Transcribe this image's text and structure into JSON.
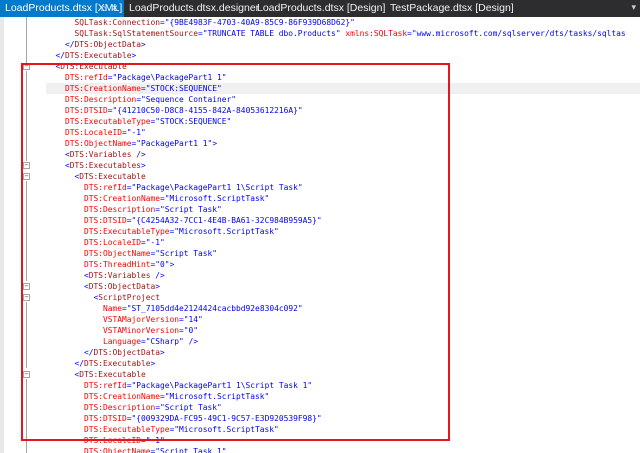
{
  "tabs": [
    {
      "label": "LoadProducts.dtsx [XML]",
      "active": true,
      "pin": "⌂",
      "close": "×"
    },
    {
      "label": "LoadProducts.dtsx.designer",
      "active": false
    },
    {
      "label": "LoadProducts.dtsx [Design]",
      "active": false
    },
    {
      "label": "TestPackage.dtsx [Design]",
      "active": false
    }
  ],
  "tab_overflow": "▾",
  "code_lines": [
    {
      "indent": 6,
      "parts": [
        [
          "e",
          "SQLTask:Connection"
        ],
        [
          "b",
          "="
        ],
        [
          "v",
          "\"{9BE4983F-4703-40A9-85C9-86F939D68D62}\""
        ]
      ]
    },
    {
      "indent": 6,
      "parts": [
        [
          "e",
          "SQLTask:SqlStatementSource"
        ],
        [
          "b",
          "="
        ],
        [
          "v",
          "\"TRUNCATE TABLE dbo.Products\""
        ],
        [
          "b",
          " "
        ],
        [
          "a",
          "xmlns:SQLTask"
        ],
        [
          "b",
          "="
        ],
        [
          "v",
          "\"www.microsoft.com/sqlserver/dts/tasks/sqltas"
        ]
      ]
    },
    {
      "indent": 4,
      "parts": [
        [
          "b",
          "</"
        ],
        [
          "e",
          "DTS:ObjectData"
        ],
        [
          "b",
          ">"
        ]
      ]
    },
    {
      "indent": 2,
      "parts": [
        [
          "b",
          "</"
        ],
        [
          "e",
          "DTS:Executable"
        ],
        [
          "b",
          ">"
        ]
      ]
    },
    {
      "indent": 2,
      "parts": [
        [
          "b",
          "<"
        ],
        [
          "e",
          "DTS:Executable"
        ]
      ]
    },
    {
      "indent": 4,
      "parts": [
        [
          "a",
          "DTS:refId"
        ],
        [
          "b",
          "="
        ],
        [
          "v",
          "\"Package\\PackagePart1 1\""
        ]
      ]
    },
    {
      "indent": 4,
      "parts": [
        [
          "a",
          "DTS:CreationName"
        ],
        [
          "b",
          "="
        ],
        [
          "v",
          "\"STOCK:SEQUENCE\""
        ]
      ],
      "current": true
    },
    {
      "indent": 4,
      "parts": [
        [
          "a",
          "DTS:Description"
        ],
        [
          "b",
          "="
        ],
        [
          "v",
          "\"Sequence Container\""
        ]
      ]
    },
    {
      "indent": 4,
      "parts": [
        [
          "a",
          "DTS:DTSID"
        ],
        [
          "b",
          "="
        ],
        [
          "v",
          "\"{41210C50-D8C8-4155-842A-84053612216A}\""
        ]
      ]
    },
    {
      "indent": 4,
      "parts": [
        [
          "a",
          "DTS:ExecutableType"
        ],
        [
          "b",
          "="
        ],
        [
          "v",
          "\"STOCK:SEQUENCE\""
        ]
      ]
    },
    {
      "indent": 4,
      "parts": [
        [
          "a",
          "DTS:LocaleID"
        ],
        [
          "b",
          "="
        ],
        [
          "v",
          "\"-1\""
        ]
      ]
    },
    {
      "indent": 4,
      "parts": [
        [
          "a",
          "DTS:ObjectName"
        ],
        [
          "b",
          "="
        ],
        [
          "v",
          "\"PackagePart1 1\""
        ],
        [
          "b",
          ">"
        ]
      ]
    },
    {
      "indent": 4,
      "parts": [
        [
          "b",
          "<"
        ],
        [
          "e",
          "DTS:Variables"
        ],
        [
          "b",
          " />"
        ]
      ]
    },
    {
      "indent": 4,
      "parts": [
        [
          "b",
          "<"
        ],
        [
          "e",
          "DTS:Executables"
        ],
        [
          "b",
          ">"
        ]
      ]
    },
    {
      "indent": 6,
      "parts": [
        [
          "b",
          "<"
        ],
        [
          "e",
          "DTS:Executable"
        ]
      ]
    },
    {
      "indent": 8,
      "parts": [
        [
          "a",
          "DTS:refId"
        ],
        [
          "b",
          "="
        ],
        [
          "v",
          "\"Package\\PackagePart1 1\\Script Task\""
        ]
      ]
    },
    {
      "indent": 8,
      "parts": [
        [
          "a",
          "DTS:CreationName"
        ],
        [
          "b",
          "="
        ],
        [
          "v",
          "\"Microsoft.ScriptTask\""
        ]
      ]
    },
    {
      "indent": 8,
      "parts": [
        [
          "a",
          "DTS:Description"
        ],
        [
          "b",
          "="
        ],
        [
          "v",
          "\"Script Task\""
        ]
      ]
    },
    {
      "indent": 8,
      "parts": [
        [
          "a",
          "DTS:DTSID"
        ],
        [
          "b",
          "="
        ],
        [
          "v",
          "\"{C4254A32-7CC1-4E4B-BA61-32C984B959A5}\""
        ]
      ]
    },
    {
      "indent": 8,
      "parts": [
        [
          "a",
          "DTS:ExecutableType"
        ],
        [
          "b",
          "="
        ],
        [
          "v",
          "\"Microsoft.ScriptTask\""
        ]
      ]
    },
    {
      "indent": 8,
      "parts": [
        [
          "a",
          "DTS:LocaleID"
        ],
        [
          "b",
          "="
        ],
        [
          "v",
          "\"-1\""
        ]
      ]
    },
    {
      "indent": 8,
      "parts": [
        [
          "a",
          "DTS:ObjectName"
        ],
        [
          "b",
          "="
        ],
        [
          "v",
          "\"Script Task\""
        ]
      ]
    },
    {
      "indent": 8,
      "parts": [
        [
          "a",
          "DTS:ThreadHint"
        ],
        [
          "b",
          "="
        ],
        [
          "v",
          "\"0\""
        ],
        [
          "b",
          ">"
        ]
      ]
    },
    {
      "indent": 8,
      "parts": [
        [
          "b",
          "<"
        ],
        [
          "e",
          "DTS:Variables"
        ],
        [
          "b",
          " />"
        ]
      ]
    },
    {
      "indent": 8,
      "parts": [
        [
          "b",
          "<"
        ],
        [
          "e",
          "DTS:ObjectData"
        ],
        [
          "b",
          ">"
        ]
      ]
    },
    {
      "indent": 10,
      "parts": [
        [
          "b",
          "<"
        ],
        [
          "e",
          "ScriptProject"
        ]
      ]
    },
    {
      "indent": 12,
      "parts": [
        [
          "a",
          "Name"
        ],
        [
          "b",
          "="
        ],
        [
          "v",
          "\"ST_7105dd4e2124424cacbbd92e8304c092\""
        ]
      ]
    },
    {
      "indent": 12,
      "parts": [
        [
          "a",
          "VSTAMajorVersion"
        ],
        [
          "b",
          "="
        ],
        [
          "v",
          "\"14\""
        ]
      ]
    },
    {
      "indent": 12,
      "parts": [
        [
          "a",
          "VSTAMinorVersion"
        ],
        [
          "b",
          "="
        ],
        [
          "v",
          "\"0\""
        ]
      ]
    },
    {
      "indent": 12,
      "parts": [
        [
          "a",
          "Language"
        ],
        [
          "b",
          "="
        ],
        [
          "v",
          "\"CSharp\""
        ],
        [
          "b",
          " />"
        ]
      ]
    },
    {
      "indent": 8,
      "parts": [
        [
          "b",
          "</"
        ],
        [
          "e",
          "DTS:ObjectData"
        ],
        [
          "b",
          ">"
        ]
      ]
    },
    {
      "indent": 6,
      "parts": [
        [
          "b",
          "</"
        ],
        [
          "e",
          "DTS:Executable"
        ],
        [
          "b",
          ">"
        ]
      ]
    },
    {
      "indent": 6,
      "parts": [
        [
          "b",
          "<"
        ],
        [
          "e",
          "DTS:Executable"
        ]
      ]
    },
    {
      "indent": 8,
      "parts": [
        [
          "a",
          "DTS:refId"
        ],
        [
          "b",
          "="
        ],
        [
          "v",
          "\"Package\\PackagePart1 1\\Script Task 1\""
        ]
      ]
    },
    {
      "indent": 8,
      "parts": [
        [
          "a",
          "DTS:CreationName"
        ],
        [
          "b",
          "="
        ],
        [
          "v",
          "\"Microsoft.ScriptTask\""
        ]
      ]
    },
    {
      "indent": 8,
      "parts": [
        [
          "a",
          "DTS:Description"
        ],
        [
          "b",
          "="
        ],
        [
          "v",
          "\"Script Task\""
        ]
      ]
    },
    {
      "indent": 8,
      "parts": [
        [
          "a",
          "DTS:DTSID"
        ],
        [
          "b",
          "="
        ],
        [
          "v",
          "\"{009329DA-FC95-49C1-9C57-E3D920539F98}\""
        ]
      ]
    },
    {
      "indent": 8,
      "parts": [
        [
          "a",
          "DTS:ExecutableType"
        ],
        [
          "b",
          "="
        ],
        [
          "v",
          "\"Microsoft.ScriptTask\""
        ]
      ]
    },
    {
      "indent": 8,
      "parts": [
        [
          "a",
          "DTS:LocaleID"
        ],
        [
          "b",
          "="
        ],
        [
          "v",
          "\"-1\""
        ]
      ]
    },
    {
      "indent": 8,
      "parts": [
        [
          "a",
          "DTS:ObjectName"
        ],
        [
          "b",
          "="
        ],
        [
          "v",
          "\"Script Task 1\""
        ]
      ]
    }
  ],
  "colors": {
    "element": "#a31515",
    "attribute": "#ff0000",
    "value": "#0000ff",
    "bracket": "#0000ff",
    "annotation_box": "#e8141c",
    "active_tab": "#007acc",
    "tab_bar": "#2d2d30"
  },
  "icons": {
    "pin": "pin-icon",
    "close": "close-icon",
    "fold": "collapse-icon",
    "overflow": "tab-overflow-icon"
  }
}
